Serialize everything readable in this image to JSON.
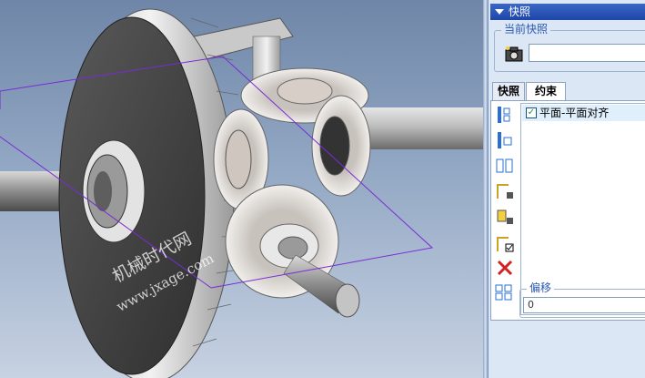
{
  "viewport": {
    "watermark_cn": "机械时代网",
    "watermark_url": "www.jxage.com"
  },
  "panel": {
    "title": "快照",
    "current_snapshot_label": "当前快照",
    "snapshot_name_value": "",
    "tabs": [
      {
        "label": "快照",
        "active": false
      },
      {
        "label": "约束",
        "active": true
      }
    ],
    "tools": [
      {
        "icon": "align-top-icon"
      },
      {
        "icon": "align-offset-icon"
      },
      {
        "icon": "align-side-icon"
      },
      {
        "icon": "lock-rotate-icon"
      },
      {
        "icon": "lock-part-icon"
      },
      {
        "icon": "check-constraint-icon"
      },
      {
        "icon": "delete-icon"
      }
    ],
    "constraints": [
      {
        "label": "平面-平面对齐",
        "checked": true
      }
    ],
    "offset_label": "偏移",
    "offset_value": "0",
    "colors": {
      "header": "#1d46a8",
      "panel_bg": "#dce7f5",
      "selection": "#dfeffb",
      "accent_text": "#2a58b0"
    }
  }
}
